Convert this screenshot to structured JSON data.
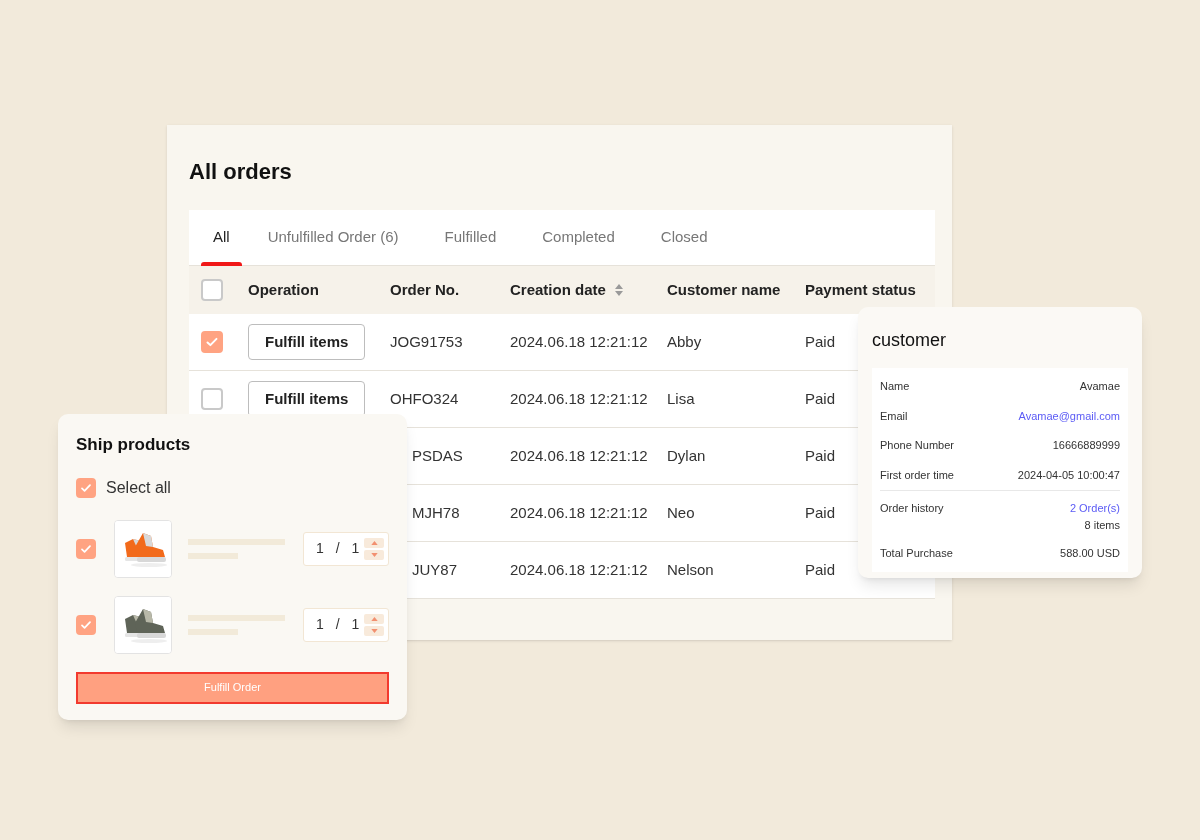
{
  "orders": {
    "title": "All orders",
    "tabs": [
      {
        "label": "All",
        "selected": true
      },
      {
        "label": "Unfulfilled Order (6)",
        "selected": false
      },
      {
        "label": "Fulfilled",
        "selected": false
      },
      {
        "label": "Completed",
        "selected": false
      },
      {
        "label": "Closed",
        "selected": false
      }
    ],
    "header_checkbox": {
      "checked": false
    },
    "columns": [
      {
        "label": "Operation"
      },
      {
        "label": "Order No."
      },
      {
        "label": "Creation date",
        "sortable": true
      },
      {
        "label": "Customer name"
      },
      {
        "label": "Payment status"
      }
    ],
    "rows": [
      {
        "checked": true,
        "operation": "Fulfill items",
        "order_no": "JOG91753",
        "date": "2024.06.18 12:21:12",
        "customer": "Abby",
        "payment": "Paid"
      },
      {
        "checked": false,
        "operation": "Fulfill items",
        "order_no": "OHFO324",
        "date": "2024.06.18 12:21:12",
        "customer": "Lisa",
        "payment": "Paid"
      },
      {
        "order_no": "PSDAS",
        "date": "2024.06.18 12:21:12",
        "customer": "Dylan",
        "payment": "Paid"
      },
      {
        "order_no": "MJH78",
        "date": "2024.06.18 12:21:12",
        "customer": "Neo",
        "payment": "Paid"
      },
      {
        "order_no": "JUY87",
        "date": "2024.06.18 12:21:12",
        "customer": "Nelson",
        "payment": "Paid"
      }
    ]
  },
  "ship_products": {
    "title": "Ship products",
    "select_all": {
      "label": "Select all",
      "checked": true
    },
    "products": [
      {
        "checked": true,
        "kind": "picture",
        "quantity": "1 / 1"
      },
      {
        "checked": true,
        "kind": "picture",
        "quantity": "1 / 1"
      }
    ],
    "button": "Fulfill Order"
  },
  "customer": {
    "title": "customer",
    "sections": [
      [
        {
          "label": "Name",
          "value": "Avamae",
          "kind": "text"
        },
        {
          "label": "Email",
          "value": "Avamae@gmail.com",
          "kind": "link"
        },
        {
          "label": "Phone Number",
          "value": "16666889999",
          "kind": "text"
        },
        {
          "label": "First order time",
          "value": "2024-04-05 10:00:47",
          "kind": "text"
        }
      ],
      [
        {
          "label": "Order history",
          "value": "2 Order(s)",
          "kind": "link",
          "note": "8 items"
        },
        {
          "label": "Total Purchase",
          "value": "588.00 USD",
          "kind": "text"
        }
      ]
    ]
  }
}
